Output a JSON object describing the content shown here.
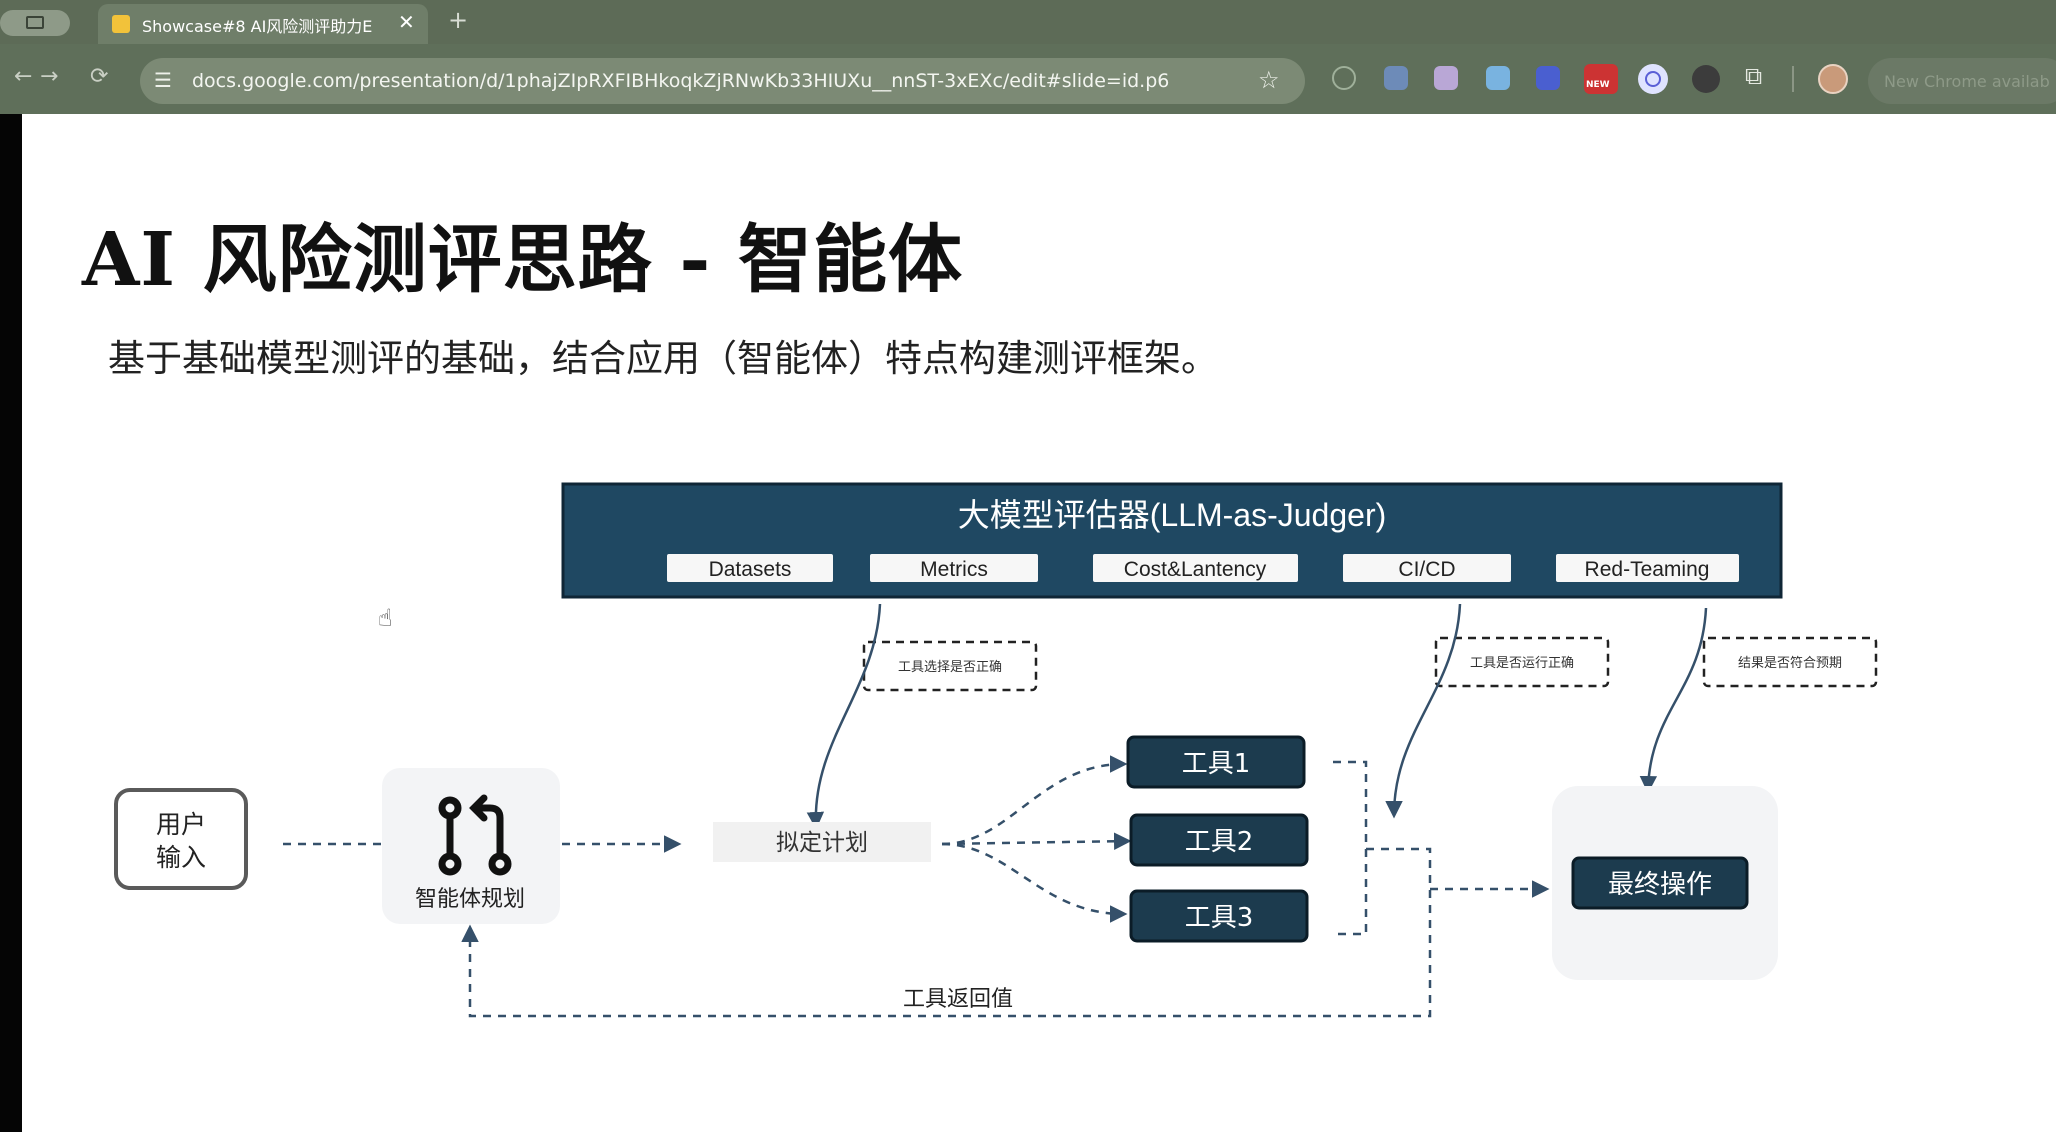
{
  "browser": {
    "tab_title": "Showcase#8 AI风险测评助力E",
    "tab_close": "✕",
    "new_tab": "+",
    "url": "docs.google.com/presentation/d/1phajZIpRXFIBHkoqkZjRNwKb33HIUXu__nnST-3xEXc/edit#slide=id.p6",
    "nav": {
      "back": "←",
      "forward": "→",
      "reload": "⟳"
    },
    "ext_new_badge": "NEW",
    "chrome_pill_text": "New Chrome availab"
  },
  "slide": {
    "title": "AI 风险测评思路 - 智能体",
    "subtitle": "基于基础模型测评的基础，结合应用（智能体）特点构建测评框架。"
  },
  "diagram": {
    "judge_title": "大模型评估器(LLM-as-Judger)",
    "judge_chips": [
      "Datasets",
      "Metrics",
      "Cost&Lantency",
      "CI/CD",
      "Red-Teaming"
    ],
    "user_input": [
      "用户",
      "输入"
    ],
    "agent_planning": "智能体规划",
    "plan": "拟定计划",
    "tools": [
      "工具1",
      "工具2",
      "工具3"
    ],
    "final_action": "最终操作",
    "tool_return": "工具返回值",
    "notes": [
      "工具选择是否正确",
      "工具是否运行正确",
      "结果是否符合预期"
    ]
  },
  "colors": {
    "judge_bg": "#1f4862",
    "tool_bg": "#1c3b4e",
    "arrow": "#35506a",
    "chrome_toolbar": "#5f6f5a"
  }
}
